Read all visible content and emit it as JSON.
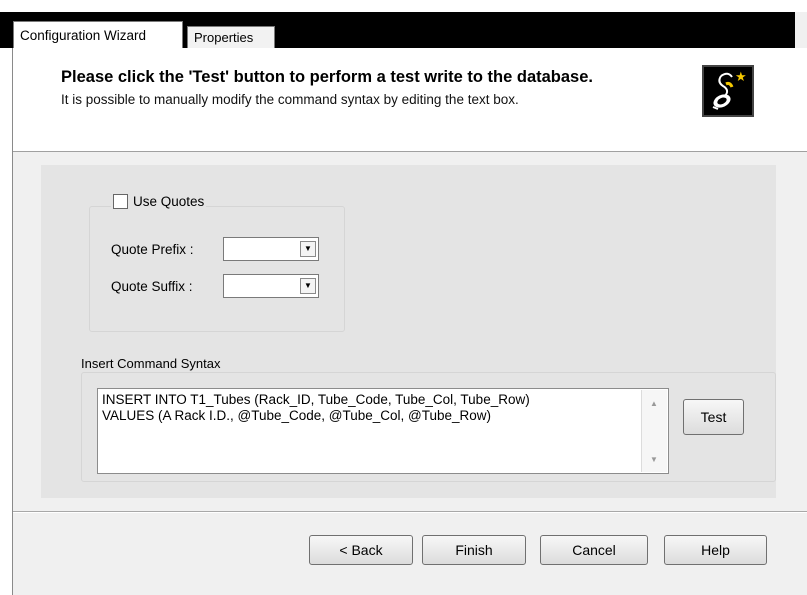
{
  "tabs": [
    {
      "label": "Configuration Wizard"
    },
    {
      "label": "Properties"
    }
  ],
  "header": {
    "title": "Please click the 'Test' button to perform a test write to the database.",
    "subtitle": "It is possible to manually modify the command syntax by editing the text box.",
    "logo_icon": "wizard-icon"
  },
  "quotes": {
    "use_quotes_label": "Use Quotes",
    "use_quotes_checked": false,
    "prefix_label": "Quote Prefix :",
    "prefix_value": "",
    "suffix_label": "Quote Suffix :",
    "suffix_value": ""
  },
  "insert": {
    "group_label": "Insert Command Syntax",
    "lines": [
      "INSERT INTO T1_Tubes (Rack_ID, Tube_Code, Tube_Col, Tube_Row)",
      "VALUES (A Rack I.D., @Tube_Code, @Tube_Col, @Tube_Row)"
    ],
    "test_label": "Test"
  },
  "footer": {
    "back_label": "< Back",
    "finish_label": "Finish",
    "cancel_label": "Cancel",
    "help_label": "Help"
  }
}
